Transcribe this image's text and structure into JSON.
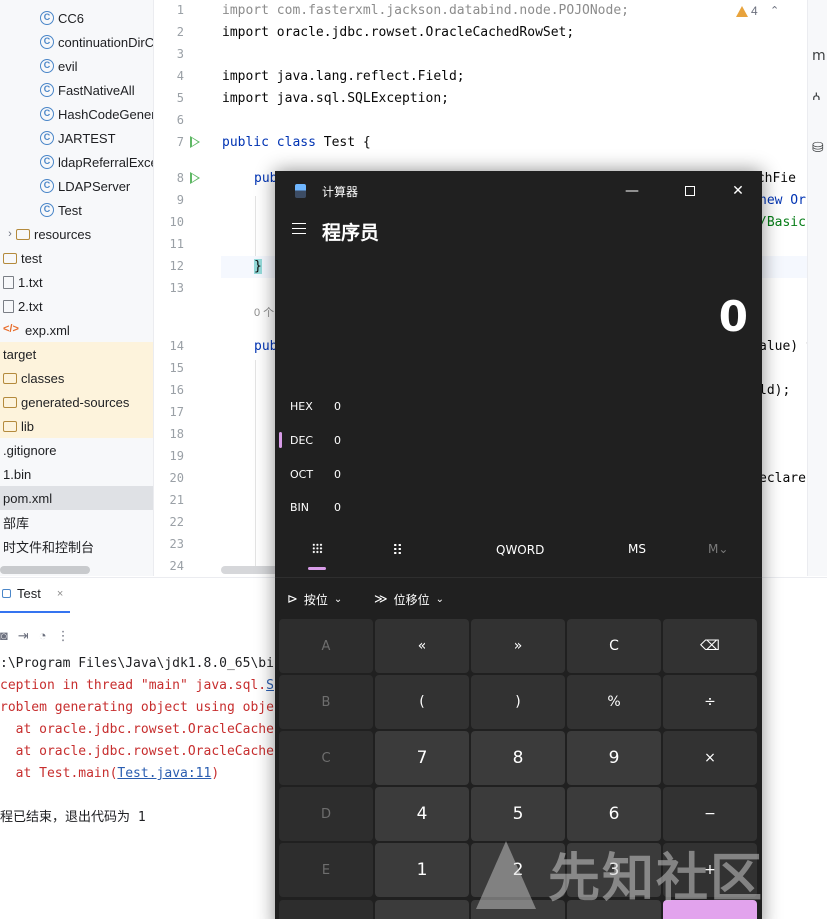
{
  "project_tree": {
    "items": [
      {
        "label": "CC6",
        "icon": "java-class-icon",
        "indent": 2
      },
      {
        "label": "continuationDirC",
        "icon": "java-class-icon",
        "indent": 2
      },
      {
        "label": "evil",
        "icon": "java-class-icon",
        "indent": 2
      },
      {
        "label": "FastNativeAll",
        "icon": "java-class-icon",
        "indent": 2
      },
      {
        "label": "HashCodeGener",
        "icon": "java-class-icon",
        "indent": 2
      },
      {
        "label": "JARTEST",
        "icon": "java-class-icon",
        "indent": 2
      },
      {
        "label": "ldapReferralExce",
        "icon": "java-class-icon",
        "indent": 2
      },
      {
        "label": "LDAPServer",
        "icon": "java-class-icon",
        "indent": 2
      },
      {
        "label": "Test",
        "icon": "java-class-icon",
        "indent": 2
      },
      {
        "label": "resources",
        "icon": "folder-icon",
        "indent": 1
      },
      {
        "label": "test",
        "icon": "folder-icon",
        "indent": 0
      },
      {
        "label": "1.txt",
        "icon": "text-file-icon",
        "indent": 0
      },
      {
        "label": "2.txt",
        "icon": "text-file-icon",
        "indent": 0
      },
      {
        "label": "exp.xml",
        "icon": "xml-file-icon",
        "indent": 0
      },
      {
        "label": "target",
        "icon": "none",
        "indent": 0
      },
      {
        "label": "classes",
        "icon": "folder-icon",
        "indent": 0
      },
      {
        "label": "generated-sources",
        "icon": "folder-icon",
        "indent": 0
      },
      {
        "label": "lib",
        "icon": "folder-icon",
        "indent": 0
      },
      {
        "label": ".gitignore",
        "icon": "none",
        "indent": 0
      },
      {
        "label": "1.bin",
        "icon": "none",
        "indent": 0
      },
      {
        "label": "pom.xml",
        "icon": "none",
        "indent": 0
      },
      {
        "label": "部库",
        "icon": "none",
        "indent": 0
      },
      {
        "label": "时文件和控制台",
        "icon": "none",
        "indent": 0
      }
    ]
  },
  "editor": {
    "line_numbers": [
      "1",
      "2",
      "3",
      "4",
      "5",
      "6",
      "7",
      "8",
      "9",
      "10",
      "11",
      "12",
      "13",
      "14",
      "15",
      "16",
      "17",
      "18",
      "19",
      "20",
      "21",
      "22",
      "23",
      "24"
    ],
    "warning_count": "4",
    "hint_usages": "0 个",
    "lines": {
      "l1": "import com.fasterxml.jackson.databind.node.POJONode;",
      "l2": "import oracle.jdbc.rowset.OracleCachedRowSet;",
      "l4": "import java.lang.reflect.Field;",
      "l5": "import java.sql.SQLException;",
      "l7_kw": "public class",
      "l7_rest": " Test {",
      "l8_kw": "pub",
      "l8_rest": "uchFie",
      "l9_tail": "new Or",
      "l10_tail": "/Basic",
      "l12": "}",
      "l14_kw": "pub",
      "l14_tail": "alue) t",
      "l16_tail": "ld);",
      "l20_tail": "eclare"
    }
  },
  "side_strip": {
    "glyphs": [
      "m",
      "ꭅ"
    ]
  },
  "run_panel": {
    "tab_label": "Test",
    "tab_close": "×",
    "lines": {
      "c1": ":\\Program Files\\Java\\jdk1.8.0_65\\bi",
      "c2_a": "ception in thread \"main\" java.sql.",
      "c2_b": "S",
      "c3": "roblem generating object using obje",
      "c4": "  at oracle.jdbc.rowset.OracleCache",
      "c5": "  at oracle.jdbc.rowset.OracleCache",
      "c6_a": "  at Test.main(",
      "c6_link": "Test.java:11",
      "c6_b": ")",
      "c8": "程已结束，退出代码为 1"
    }
  },
  "calculator": {
    "window_title": "计算器",
    "mode_title": "程序员",
    "display_value": "0",
    "radix": [
      {
        "label": "HEX",
        "value": "0"
      },
      {
        "label": "DEC",
        "value": "0"
      },
      {
        "label": "OCT",
        "value": "0"
      },
      {
        "label": "BIN",
        "value": "0"
      }
    ],
    "keyboard_tabs": {
      "word_size": "QWORD",
      "ms": "MS",
      "m_dropdown": "M⌄"
    },
    "bit_toolbar": {
      "bitwise": "按位",
      "bitshift": "位移位"
    },
    "keys": [
      [
        "A",
        "«",
        "»",
        "C",
        "⌫"
      ],
      [
        "B",
        "(",
        ")",
        "%",
        "÷"
      ],
      [
        "C",
        "7",
        "8",
        "9",
        "×"
      ],
      [
        "D",
        "4",
        "5",
        "6",
        "−"
      ],
      [
        "E",
        "1",
        "2",
        "3",
        "+"
      ]
    ],
    "colors": {
      "accent": "#e2a3ed",
      "background": "#202020"
    }
  },
  "watermark": {
    "text": "先知社区"
  }
}
